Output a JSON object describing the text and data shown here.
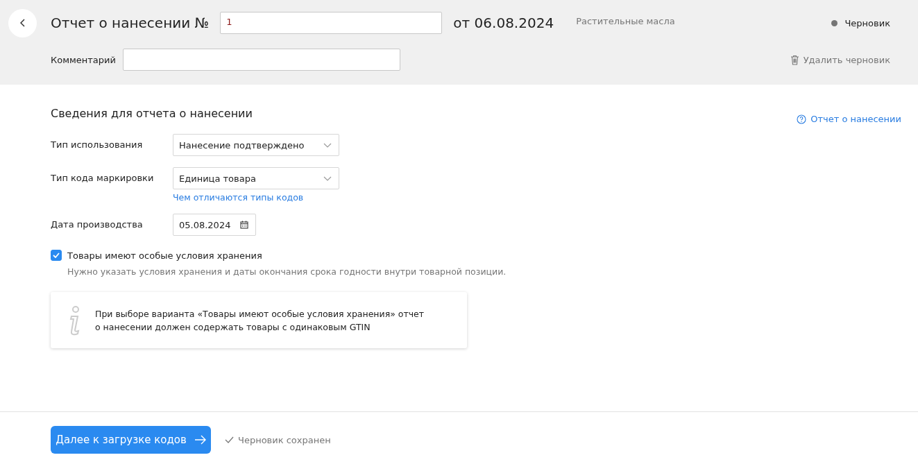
{
  "header": {
    "title": "Отчет о нанесении №",
    "number": {
      "value": "1"
    },
    "date": "от 06.08.2024",
    "category": "Растительные масла",
    "status": "Черновик",
    "comment": {
      "label": "Комментарий"
    },
    "delete_action": "Удалить черновик"
  },
  "section": {
    "title": "Сведения для отчета о нанесении",
    "help_link": "Отчет о нанесении",
    "fields": [
      {
        "kind": "select",
        "label": "Тип использования",
        "value": "Нанесение подтверждено"
      },
      {
        "kind": "select",
        "label": "Тип кода маркировки",
        "value": "Единица товара",
        "link": "Чем отличаются типы кодов"
      },
      {
        "kind": "date",
        "label": "Дата производства",
        "value": "05.08.2024"
      }
    ],
    "checkbox": {
      "label": "Товары имеют особые условия хранения",
      "checked": true,
      "hint": "Нужно указать условия хранения и даты окончания срока годности внутри товарной позиции."
    },
    "info": [
      "При выборе варианта «Товары имеют особые условия хранения» отчет",
      "о нанесении должен содержать товары с одинаковым GTIN"
    ]
  },
  "footer": {
    "primary_button": "Далее к загрузке кодов",
    "saved_status": "Черновик сохранен"
  }
}
